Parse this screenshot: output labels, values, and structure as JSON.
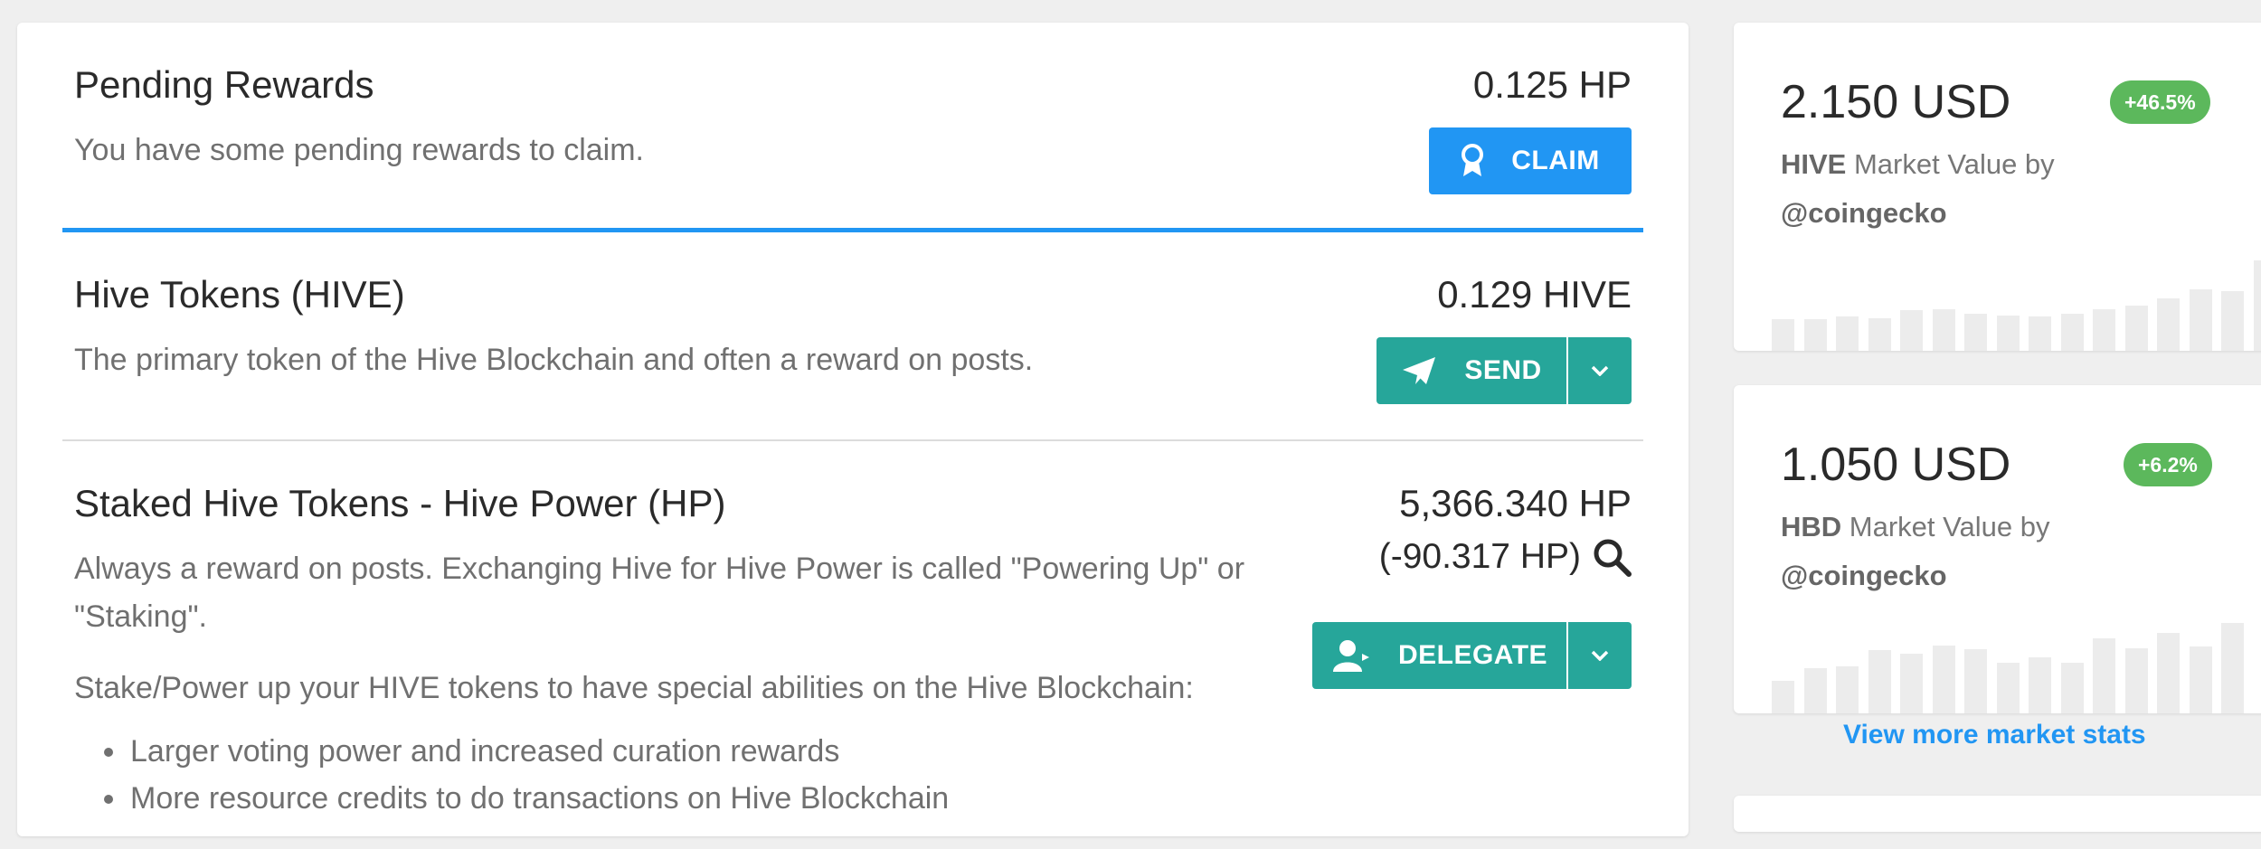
{
  "pending": {
    "title": "Pending Rewards",
    "description": "You have some pending rewards to claim.",
    "amount": "0.125 HP",
    "claim_label": "CLAIM"
  },
  "hive": {
    "title": "Hive Tokens (HIVE)",
    "description": "The primary token of the Hive Blockchain and often a reward on posts.",
    "amount": "0.129 HIVE",
    "send_label": "SEND"
  },
  "hp": {
    "title": "Staked Hive Tokens - Hive Power (HP)",
    "description": "Always a reward on posts. Exchanging Hive for Hive Power is called \"Powering Up\" or \"Staking\".",
    "amount": "5,366.340 HP",
    "delegated": "(-90.317 HP)",
    "delegate_label": "DELEGATE",
    "abilities_intro": "Stake/Power up your HIVE tokens to have special abilities on the Hive Blockchain:",
    "abilities": [
      "Larger voting power and increased curation rewards",
      "More resource credits to do transactions on Hive Blockchain"
    ]
  },
  "market": [
    {
      "price": "2.150 USD",
      "change": "+46.5%",
      "symbol": "HIVE",
      "label": "Market Value by",
      "source": "@coingecko",
      "sparkline": [
        0.35,
        0.35,
        0.38,
        0.36,
        0.45,
        0.46,
        0.41,
        0.39,
        0.38,
        0.41,
        0.46,
        0.5,
        0.58,
        0.68,
        0.66,
        1.0
      ]
    },
    {
      "price": "1.050 USD",
      "change": "+6.2%",
      "symbol": "HBD",
      "label": "Market Value by",
      "source": "@coingecko",
      "sparkline": [
        0.36,
        0.5,
        0.52,
        0.7,
        0.66,
        0.75,
        0.71,
        0.56,
        0.62,
        0.56,
        0.83,
        0.72,
        0.89,
        0.74,
        1.0
      ]
    }
  ],
  "view_more_label": "View more market stats",
  "colors": {
    "claim": "#2196f3",
    "action": "#26a69a",
    "badge": "#5cb85c",
    "link": "#2196f3"
  }
}
